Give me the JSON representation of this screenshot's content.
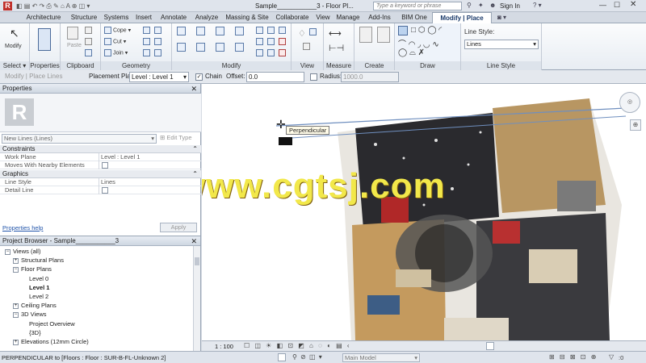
{
  "title_bar": {
    "doc_title": "Sample___________3 - Floor Pl...",
    "search_placeholder": "Type a keyword or phrase",
    "sign_in": "Sign In"
  },
  "tabs": [
    "Architecture",
    "Structure",
    "Systems",
    "Insert",
    "Annotate",
    "Analyze",
    "Massing & Site",
    "Collaborate",
    "View",
    "Manage",
    "Add-Ins",
    "BIM One",
    "Modify | Place Lines"
  ],
  "ribbon": {
    "modify_label": "Modify",
    "panels": [
      "Select ▾",
      "Properties",
      "Clipboard",
      "Geometry",
      "Modify",
      "View",
      "Measure",
      "Create",
      "Draw",
      "Line Style"
    ],
    "paste_label": "Paste",
    "cope_label": "Cope",
    "cut_label": "Cut",
    "join_label": "Join",
    "line_style_label": "Line Style:",
    "line_style_value": "Lines"
  },
  "options_bar": {
    "mode": "Modify | Place Lines",
    "placement_plane_label": "Placement Plane:",
    "placement_plane_value": "Level : Level 1",
    "chain_label": "Chain",
    "chain_checked": true,
    "offset_label": "Offset:",
    "offset_value": "0.0",
    "radius_label": "Radius:",
    "radius_value": "1000.0"
  },
  "properties": {
    "title": "Properties",
    "type_selector": "New Lines (Lines)",
    "edit_type": "Edit Type",
    "sections": [
      {
        "name": "Constraints",
        "rows": [
          {
            "k": "Work Plane",
            "v": "Level : Level 1"
          },
          {
            "k": "Moves With Nearby Elements",
            "v": ""
          }
        ]
      },
      {
        "name": "Graphics",
        "rows": [
          {
            "k": "Line Style",
            "v": "Lines"
          },
          {
            "k": "Detail Line",
            "v": ""
          }
        ]
      }
    ],
    "help_link": "Properties help",
    "apply": "Apply"
  },
  "project_browser": {
    "title": "Project Browser - Sample___________3",
    "items": [
      {
        "label": "Views (all)",
        "level": 0,
        "toggle": "−"
      },
      {
        "label": "Structural Plans",
        "level": 1,
        "toggle": "+"
      },
      {
        "label": "Floor Plans",
        "level": 1,
        "toggle": "−"
      },
      {
        "label": "Level 0",
        "level": 2,
        "toggle": ""
      },
      {
        "label": "Level 1",
        "level": 2,
        "toggle": "",
        "bold": true
      },
      {
        "label": "Level 2",
        "level": 2,
        "toggle": ""
      },
      {
        "label": "Ceiling Plans",
        "level": 1,
        "toggle": "+"
      },
      {
        "label": "3D Views",
        "level": 1,
        "toggle": "−"
      },
      {
        "label": "Project Overview",
        "level": 2,
        "toggle": ""
      },
      {
        "label": "{3D}",
        "level": 2,
        "toggle": ""
      },
      {
        "label": "Elevations (12mm Circle)",
        "level": 1,
        "toggle": "+"
      }
    ]
  },
  "canvas": {
    "tooltip": "Perpendicular",
    "watermark": "www.cgtsj.com"
  },
  "view_bar": {
    "scale": "1 : 100"
  },
  "status_bar": {
    "message": "PERPENDICULAR  to [Floors : Floor : SUR-B-FL-Unknown 2]",
    "model": "Main Model",
    "filter_count": ":0"
  },
  "colors": {
    "accent": "#1a3a6a",
    "selection": "#6f8fbf",
    "watermark": "#f2e84a"
  }
}
